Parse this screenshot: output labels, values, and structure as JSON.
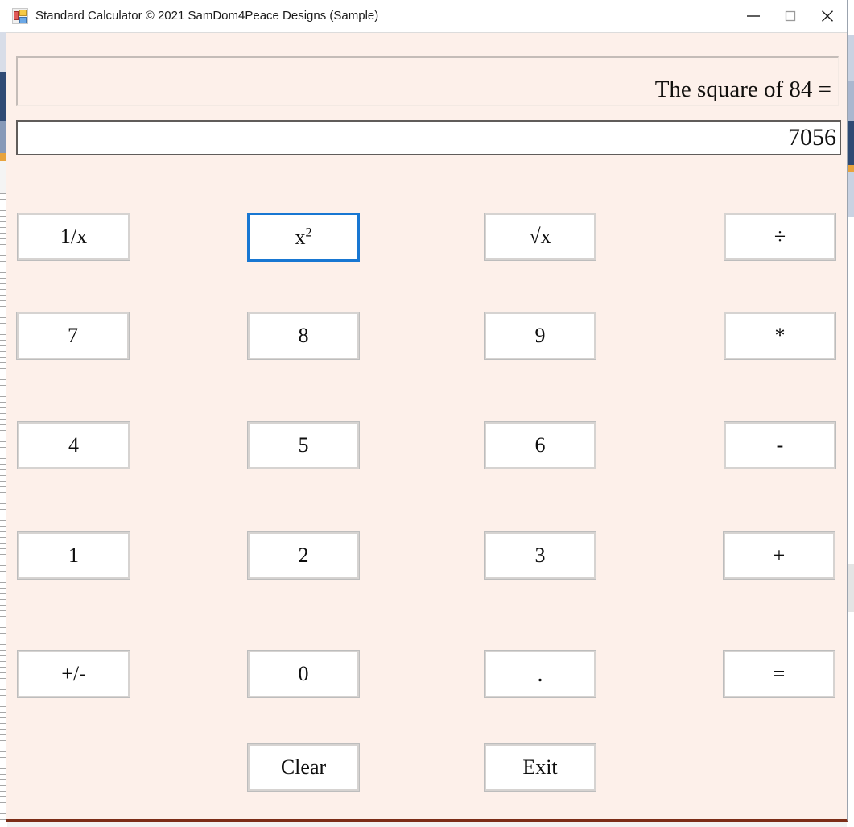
{
  "window": {
    "title": "Standard Calculator © 2021 SamDom4Peace Designs (Sample)",
    "app_icon": "windows-forms-icon",
    "background_color": "#fdf0ea",
    "bottom_border_color": "#7c2d17",
    "controls": {
      "minimize": "minimize-icon",
      "maximize": "maximize-icon",
      "close": "close-icon"
    }
  },
  "display": {
    "expression": "The square of 84 =",
    "result": "7056"
  },
  "keypad": {
    "focused_button": "x²",
    "focus_color": "#1877d2",
    "rows": [
      [
        {
          "label": "1/x",
          "name": "reciprocal"
        },
        {
          "label": "x2",
          "name": "square",
          "html": "x<sup>2</sup>",
          "focused": true
        },
        {
          "label": "√x",
          "name": "square-root"
        },
        {
          "label": "÷",
          "name": "divide"
        }
      ],
      [
        {
          "label": "7",
          "name": "digit-7"
        },
        {
          "label": "8",
          "name": "digit-8"
        },
        {
          "label": "9",
          "name": "digit-9"
        },
        {
          "label": "*",
          "name": "multiply"
        }
      ],
      [
        {
          "label": "4",
          "name": "digit-4"
        },
        {
          "label": "5",
          "name": "digit-5"
        },
        {
          "label": "6",
          "name": "digit-6"
        },
        {
          "label": "-",
          "name": "subtract"
        }
      ],
      [
        {
          "label": "1",
          "name": "digit-1"
        },
        {
          "label": "2",
          "name": "digit-2"
        },
        {
          "label": "3",
          "name": "digit-3"
        },
        {
          "label": "+",
          "name": "add"
        }
      ],
      [
        {
          "label": "+/-",
          "name": "sign-toggle"
        },
        {
          "label": "0",
          "name": "digit-0"
        },
        {
          "label": ".",
          "name": "decimal-point"
        },
        {
          "label": "=",
          "name": "equals"
        }
      ],
      [
        {
          "label": "Clear",
          "name": "clear"
        },
        {
          "label": "Exit",
          "name": "exit"
        }
      ]
    ]
  }
}
